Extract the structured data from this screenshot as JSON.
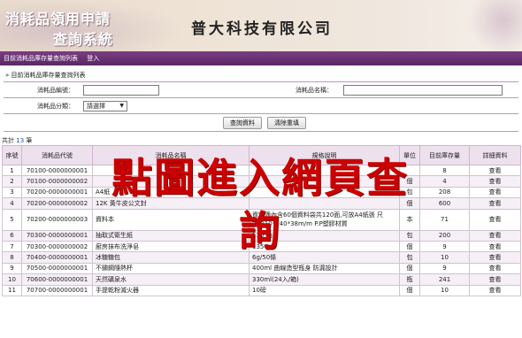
{
  "header": {
    "system_title_line1": "消耗品領用申請",
    "system_title_line2": "查詢系統",
    "company": "普大科技有限公司"
  },
  "menu": {
    "items": [
      "目前消耗品庫存量查詢列表",
      "登入"
    ]
  },
  "breadcrumb": "» 目前消耗品庫存量查詢列表",
  "search": {
    "code_label": "消耗品編號：",
    "code_value": "",
    "name_label": "消耗品名稱：",
    "name_value": "",
    "category_label": "消耗品分類：",
    "category_selected": "請選擇",
    "query_button": "查詢資料",
    "clear_button": "清除重填"
  },
  "summary": {
    "prefix": "共計",
    "count": "13",
    "suffix": "筆"
  },
  "overlay_text": "點圖進入網頁查詢",
  "table": {
    "headers": [
      "序號",
      "消耗品代號",
      "消耗品名稱",
      "規格說明",
      "單位",
      "目前庫存量",
      "詳細資料"
    ],
    "rows": [
      {
        "no": "1",
        "code": "70100-0000000001",
        "name": "",
        "spec": "",
        "unit": "",
        "stock": "8",
        "action": "查看"
      },
      {
        "no": "2",
        "code": "70100-0000000002",
        "name": "",
        "spec": "",
        "unit": "個",
        "stock": "4",
        "action": "查看"
      },
      {
        "no": "3",
        "code": "70200-0000000001",
        "name": "A4紙",
        "spec": "",
        "unit": "包",
        "stock": "208",
        "action": "查看"
      },
      {
        "no": "4",
        "code": "70200-0000000002",
        "name": "12K 黃牛皮公文封",
        "spec": "",
        "unit": "個",
        "stock": "600",
        "action": "查看"
      },
      {
        "no": "5",
        "code": "70200-0000000003",
        "name": "資料本",
        "spec": "資料簿內含60個資料袋共120面,可放A4紙張 尺寸:310*240*38m/m P.P塑膠材質",
        "unit": "本",
        "stock": "71",
        "action": "查看"
      },
      {
        "no": "6",
        "code": "70300-0000000001",
        "name": "抽取式衛生紙",
        "spec": "110 抽",
        "unit": "包",
        "stock": "200",
        "action": "查看"
      },
      {
        "no": "7",
        "code": "70300-0000000002",
        "name": "廚房抹布洗淨皂",
        "spec": "135G",
        "unit": "個",
        "stock": "9",
        "action": "查看"
      },
      {
        "no": "8",
        "code": "70400-0000000001",
        "name": "冰糖糖包",
        "spec": "6g/50條",
        "unit": "包",
        "stock": "10",
        "action": "查看"
      },
      {
        "no": "9",
        "code": "70500-0000000001",
        "name": "不鏽鋼隨熱杯",
        "spec": "400ml 曲線造型瓶身 防漏設計",
        "unit": "個",
        "stock": "9",
        "action": "查看"
      },
      {
        "no": "10",
        "code": "70600-0000000001",
        "name": "天然礦泉水",
        "spec": "330ml(24入/箱)",
        "unit": "瓶",
        "stock": "241",
        "action": "查看"
      },
      {
        "no": "11",
        "code": "70700-0000000001",
        "name": "手提乾粉滅火器",
        "spec": "10磅",
        "unit": "個",
        "stock": "10",
        "action": "查看"
      }
    ]
  },
  "colors": {
    "menubar": "#5a2766",
    "table_header": "#eee1ee",
    "link": "#1f4fa6",
    "overlay": "#cc0000"
  }
}
